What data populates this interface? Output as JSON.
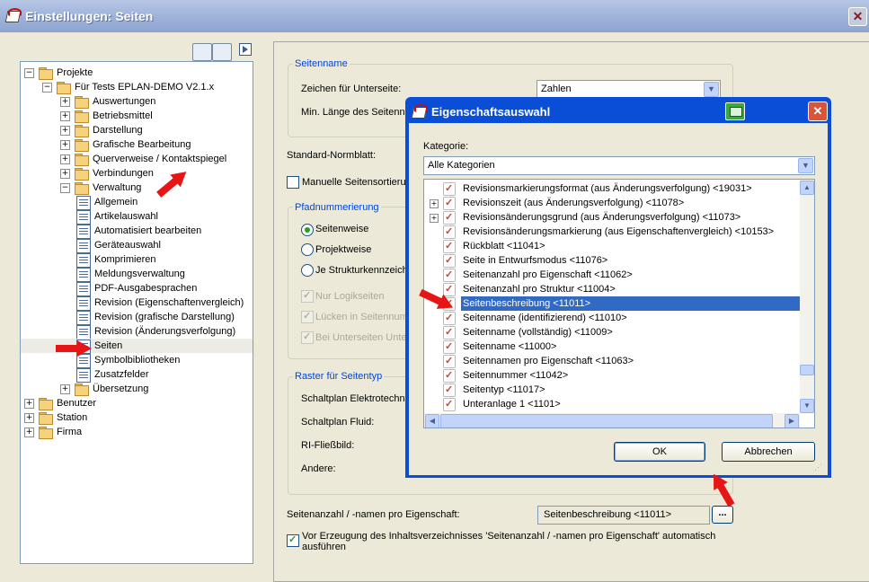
{
  "window": {
    "title": "Einstellungen: Seiten",
    "close_glyph": "✕"
  },
  "tree": {
    "nodes": [
      {
        "label": "Projekte",
        "expander": "−",
        "icon": "folder"
      },
      {
        "label": "Für Tests EPLAN-DEMO V2.1.x",
        "expander": "−",
        "icon": "folder"
      },
      {
        "label": "Auswertungen",
        "expander": "+",
        "icon": "folder"
      },
      {
        "label": "Betriebsmittel",
        "expander": "+",
        "icon": "folder"
      },
      {
        "label": "Darstellung",
        "expander": "+",
        "icon": "folder"
      },
      {
        "label": "Grafische Bearbeitung",
        "expander": "+",
        "icon": "folder"
      },
      {
        "label": "Querverweise / Kontaktspiegel",
        "expander": "+",
        "icon": "folder"
      },
      {
        "label": "Verbindungen",
        "expander": "+",
        "icon": "folder"
      },
      {
        "label": "Verwaltung",
        "expander": "−",
        "icon": "folder"
      },
      {
        "label": "Allgemein",
        "icon": "page"
      },
      {
        "label": "Artikelauswahl",
        "icon": "page"
      },
      {
        "label": "Automatisiert bearbeiten",
        "icon": "page"
      },
      {
        "label": "Geräteauswahl",
        "icon": "page"
      },
      {
        "label": "Komprimieren",
        "icon": "page"
      },
      {
        "label": "Meldungsverwaltung",
        "icon": "page"
      },
      {
        "label": "PDF-Ausgabesprachen",
        "icon": "page"
      },
      {
        "label": "Revision (Eigenschaftenvergleich)",
        "icon": "page"
      },
      {
        "label": "Revision (grafische Darstellung)",
        "icon": "page"
      },
      {
        "label": "Revision (Änderungsverfolgung)",
        "icon": "page"
      },
      {
        "label": "Seiten",
        "icon": "page",
        "selected": true
      },
      {
        "label": "Symbolbibliotheken",
        "icon": "page"
      },
      {
        "label": "Zusatzfelder",
        "icon": "page"
      },
      {
        "label": "Übersetzung",
        "expander": "+",
        "icon": "folder"
      },
      {
        "label": "Benutzer",
        "expander": "+",
        "icon": "folder"
      },
      {
        "label": "Station",
        "expander": "+",
        "icon": "folder"
      },
      {
        "label": "Firma",
        "expander": "+",
        "icon": "folder"
      }
    ]
  },
  "settings": {
    "seitenname_group": "Seitenname",
    "zeichen_label": "Zeichen für Unterseite:",
    "zeichen_value": "Zahlen",
    "min_laenge_label": "Min. Länge des Seitenna",
    "standard_normblatt_label": "Standard-Normblatt:",
    "manuelle_label": "Manuelle Seitensortierun",
    "pfad_group": "Pfadnummerierung",
    "radio_seitenweise": "Seitenweise",
    "radio_projektweise": "Projektweise",
    "radio_struktur": "Je Strukturkennzeich",
    "chk_logik": "Nur Logikseiten",
    "chk_luecken": "Lücken in Seitennumm",
    "chk_unterseiten": "Bei Unterseiten Unter",
    "raster_group": "Raster für Seitentyp",
    "schaltplan_elektro": "Schaltplan Elektrotechnik",
    "schaltplan_fluid": "Schaltplan Fluid:",
    "ri_fliessbild": "RI-Fließbild:",
    "andere": "Andere:",
    "seitenanzahl_label": "Seitenanzahl / -namen pro Eigenschaft:",
    "seitenanzahl_value": "Seitenbeschreibung <11011>",
    "browse_label": "...",
    "vor_erzeugung_line1": "Vor Erzeugung des Inhaltsverzeichnisses 'Seitenanzahl / -namen pro Eigenschaft' automatisch",
    "vor_erzeugung_line2": "ausführen"
  },
  "dialog": {
    "title": "Eigenschaftsauswahl",
    "kategorie_label": "Kategorie:",
    "kategorie_value": "Alle Kategorien",
    "items": [
      {
        "label": "Revisionsmarkierungsformat (aus Änderungsverfolgung) <19031>"
      },
      {
        "label": "Revisionszeit (aus Änderungsverfolgung) <11078>",
        "expander": "+"
      },
      {
        "label": "Revisionsänderungsgrund (aus Änderungsverfolgung) <11073>",
        "expander": "+"
      },
      {
        "label": "Revisionsänderungsmarkierung (aus Eigenschaftenvergleich) <10153>"
      },
      {
        "label": "Rückblatt <11041>"
      },
      {
        "label": "Seite in Entwurfsmodus <11076>"
      },
      {
        "label": "Seitenanzahl pro Eigenschaft <11062>"
      },
      {
        "label": "Seitenanzahl pro Struktur <11004>"
      },
      {
        "label": "Seitenbeschreibung <11011>",
        "selected": true
      },
      {
        "label": "Seitenname (identifizierend) <11010>"
      },
      {
        "label": "Seitenname (vollständig) <11009>"
      },
      {
        "label": "Seitenname <11000>"
      },
      {
        "label": "Seitennamen pro Eigenschaft <11063>"
      },
      {
        "label": "Seitennummer <11042>"
      },
      {
        "label": "Seitentyp <11017>"
      },
      {
        "label": "Unteranlage 1 <1101>"
      }
    ],
    "ok_label": "OK",
    "cancel_label": "Abbrechen"
  },
  "colors": {
    "selection": "#316ac5",
    "arrow": "#e61616",
    "group_title": "#0046d5"
  }
}
